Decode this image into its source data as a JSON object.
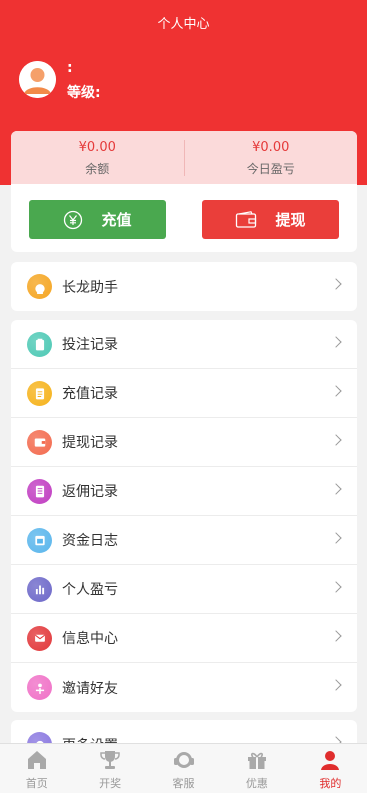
{
  "header": {
    "title": "个人中心"
  },
  "user": {
    "name_line": ":",
    "level_line": "等级:"
  },
  "balance": {
    "balance_value": "¥0.00",
    "balance_label": "余额",
    "today_value": "¥0.00",
    "today_label": "今日盈亏",
    "recharge_label": "充值",
    "withdraw_label": "提现"
  },
  "menu_top": [
    {
      "label": "长龙助手",
      "icon": "bulb-icon",
      "color": "#f5a623"
    }
  ],
  "menu_main": [
    {
      "label": "投注记录",
      "icon": "clipboard-icon",
      "color": "#4ec9b5"
    },
    {
      "label": "充值记录",
      "icon": "document-icon",
      "color": "#f6b31c"
    },
    {
      "label": "提现记录",
      "icon": "wallet-icon",
      "color": "#f36b4f"
    },
    {
      "label": "返佣记录",
      "icon": "receipt-icon",
      "color": "#c13ec2"
    },
    {
      "label": "资金日志",
      "icon": "calendar-icon",
      "color": "#5ab6ec"
    },
    {
      "label": "个人盈亏",
      "icon": "bar-chart-icon",
      "color": "#6d68c9"
    },
    {
      "label": "信息中心",
      "icon": "mail-icon",
      "color": "#e2383b"
    },
    {
      "label": "邀请好友",
      "icon": "share-icon",
      "color": "#f071c7"
    }
  ],
  "menu_bottom": [
    {
      "label": "更多设置",
      "icon": "settings-icon",
      "color": "#8a78e0"
    }
  ],
  "tabbar": [
    {
      "label": "首页",
      "icon": "home-icon",
      "active": false
    },
    {
      "label": "开奖",
      "icon": "trophy-icon",
      "active": false
    },
    {
      "label": "客服",
      "icon": "headset-icon",
      "active": false
    },
    {
      "label": "优惠",
      "icon": "gift-icon",
      "active": false
    },
    {
      "label": "我的",
      "icon": "user-icon",
      "active": true
    }
  ]
}
